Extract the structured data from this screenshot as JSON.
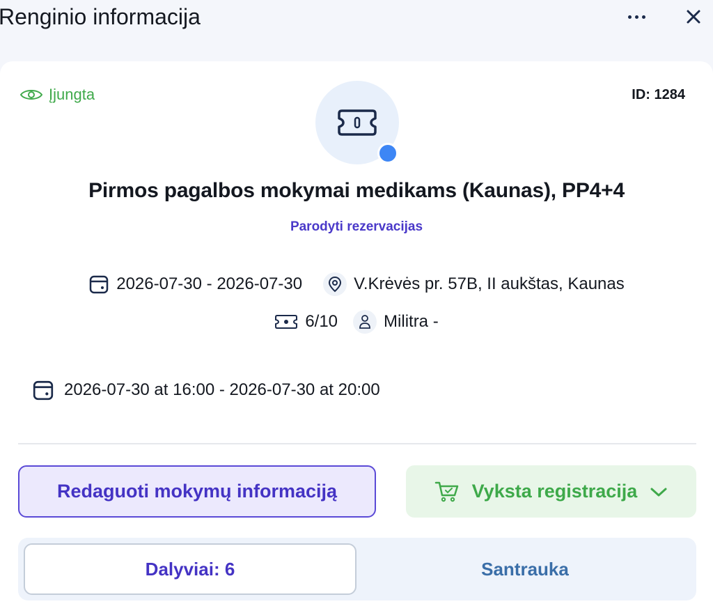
{
  "header": {
    "title": "Renginio informacija"
  },
  "card": {
    "visibility_label": "Įjungta",
    "id_label": "ID: 1284",
    "event_title": "Pirmos pagalbos mokymai medikams (Kaunas), PP4+4",
    "show_reservations_link": "Parodyti rezervacijas",
    "date_range": "2026-07-30 - 2026-07-30",
    "location": "V.Krėvės pr. 57B, II aukštas, Kaunas",
    "tickets": "6/10",
    "organizer": "Militra -",
    "session": "2026-07-30 at 16:00 - 2026-07-30 at 20:00",
    "edit_button": "Redaguoti mokymų informaciją",
    "status_dropdown": "Vyksta registracija",
    "tabs": [
      {
        "label": "Dalyviai: 6",
        "active": true
      },
      {
        "label": "Santrauka",
        "active": false
      }
    ]
  },
  "colors": {
    "accent": "#4433c4",
    "success": "#3fa94a",
    "status_dot": "#3d86f5",
    "icon_navy": "#1b2a4a"
  },
  "icons": {
    "visibility": "eye-icon",
    "event": "ticket-icon",
    "calendar": "calendar-icon",
    "location": "location-pin-icon",
    "ticket_count": "ticket-icon",
    "organizer": "user-icon",
    "cart": "cart-icon",
    "chevron": "chevron-down-icon",
    "more": "more-icon",
    "close": "close-icon"
  }
}
